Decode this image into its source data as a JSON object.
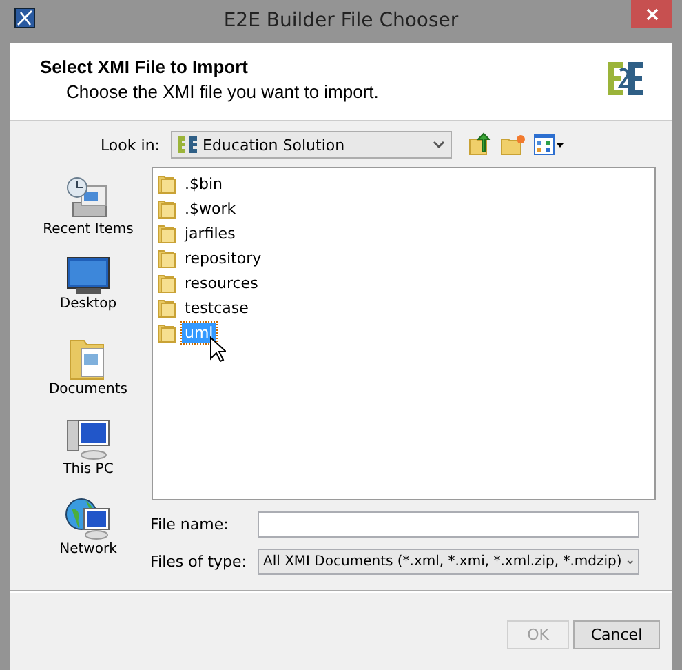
{
  "window": {
    "title": "E2E Builder File Chooser"
  },
  "header": {
    "title": "Select XMI File to Import",
    "subtitle": "Choose the XMI file you want to import."
  },
  "look_in": {
    "label": "Look in:",
    "value": "Education Solution"
  },
  "places": [
    {
      "kind": "recent",
      "label": "Recent Items"
    },
    {
      "kind": "desktop",
      "label": "Desktop"
    },
    {
      "kind": "documents",
      "label": "Documents"
    },
    {
      "kind": "pc",
      "label": "This PC"
    },
    {
      "kind": "network",
      "label": "Network"
    }
  ],
  "files": [
    {
      "name": ".$bin",
      "selected": false
    },
    {
      "name": ".$work",
      "selected": false
    },
    {
      "name": "jarfiles",
      "selected": false
    },
    {
      "name": "repository",
      "selected": false
    },
    {
      "name": "resources",
      "selected": false
    },
    {
      "name": "testcase",
      "selected": false
    },
    {
      "name": "uml",
      "selected": true
    }
  ],
  "file_name": {
    "label": "File name:"
  },
  "file_type": {
    "label": "Files of type:",
    "value": "All XMI Documents (*.xml, *.xmi, *.xml.zip, *.mdzip)"
  },
  "buttons": [
    {
      "label": "OK",
      "disabled": true
    },
    {
      "label": "Cancel",
      "disabled": false
    }
  ]
}
